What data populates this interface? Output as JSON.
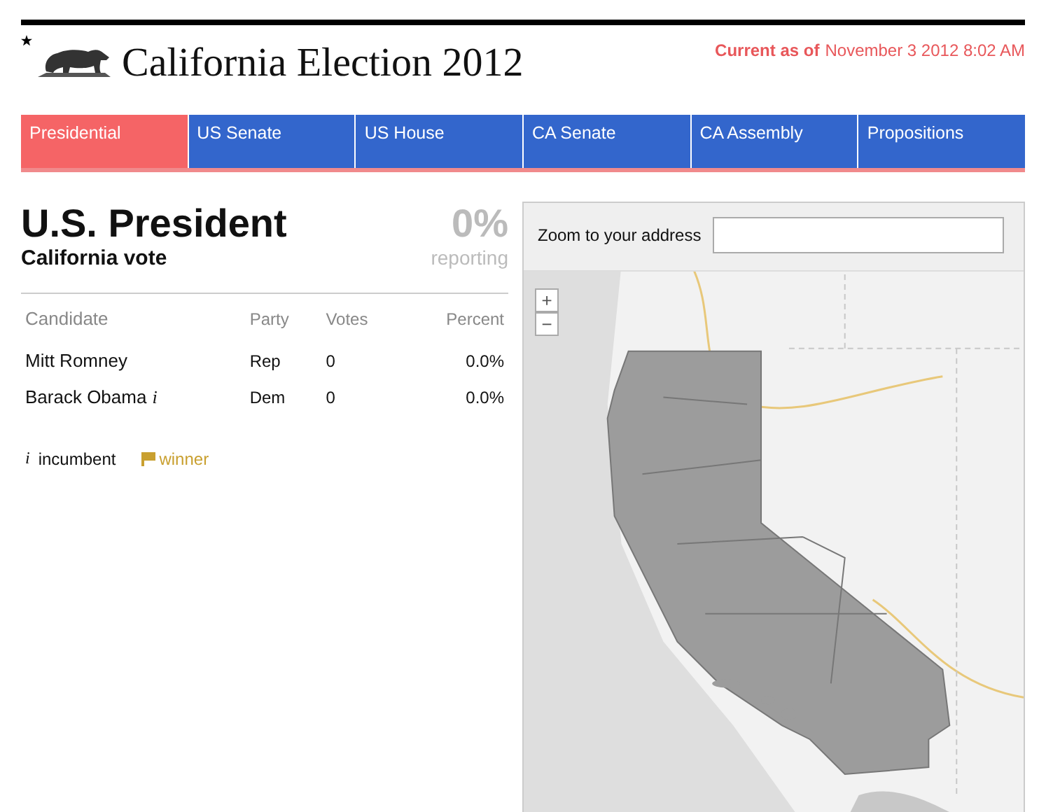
{
  "header": {
    "title": "California Election 2012",
    "updated_label": "Current as of",
    "updated_time": "November 3 2012 8:02 AM"
  },
  "tabs": [
    {
      "label": "Presidential",
      "selected": true
    },
    {
      "label": "US Senate",
      "selected": false
    },
    {
      "label": "US House",
      "selected": false
    },
    {
      "label": "CA Senate",
      "selected": false
    },
    {
      "label": "CA Assembly",
      "selected": false
    },
    {
      "label": "Propositions",
      "selected": false
    }
  ],
  "race": {
    "title": "U.S. President",
    "subtitle": "California vote",
    "reporting_value": "0%",
    "reporting_label": "reporting"
  },
  "table": {
    "columns": [
      "Candidate",
      "Party",
      "Votes",
      "Percent"
    ],
    "rows": [
      {
        "candidate": "Mitt Romney",
        "party": "Rep",
        "votes": "0",
        "percent": "0.0%"
      },
      {
        "candidate": "Barack Obama",
        "incumbent_mark": "i",
        "party": "Dem",
        "votes": "0",
        "percent": "0.0%"
      }
    ]
  },
  "legend": {
    "incumbent_mark": "i",
    "incumbent_label": "incumbent",
    "winner_label": "winner"
  },
  "map": {
    "address_label": "Zoom to your address",
    "zoom_in": "+",
    "zoom_out": "−"
  }
}
